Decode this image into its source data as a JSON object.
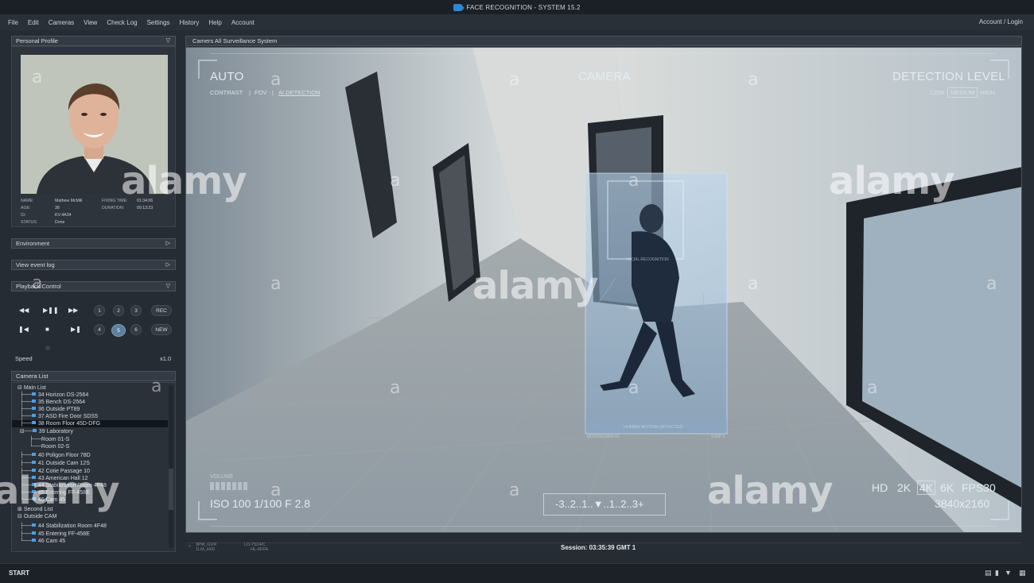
{
  "window": {
    "title": "FACE RECOGNITION - SYSTEM 15.2"
  },
  "menu": {
    "items": [
      "File",
      "Edit",
      "Cameras",
      "View",
      "Check Log",
      "Settings",
      "History",
      "Help",
      "Account"
    ],
    "account_login": "Account / Login"
  },
  "profile": {
    "header": "Personal Profile",
    "fields": {
      "name_label": "NAME:",
      "name": "Mathew McMill",
      "age_label": "AGE:",
      "age": "38",
      "id_label": "ID:",
      "id": "KV-4A34",
      "status_label": "STATUS:",
      "status": "Done",
      "fixing_label": "FIXING TIME:",
      "fixing": "01:34:06",
      "duration_label": "DURATION:",
      "duration": "00:13:23"
    }
  },
  "sections": {
    "environment": "Environment",
    "event_log": "View event log",
    "playback": "Playback Control"
  },
  "playback": {
    "buttons_row1": [
      "1",
      "2",
      "3"
    ],
    "rec": "REC",
    "buttons_row2": [
      "4",
      "5",
      "6"
    ],
    "new": "NEW",
    "active_channel": "5",
    "speed_label": "Speed",
    "speed_value": "x1.0"
  },
  "camera_list": {
    "header": "Camera List",
    "rows": [
      "Main List",
      "34 Horizon DS-2564",
      "35 Bench DS-2564",
      "36 Outside PT89",
      "37 ASD Fire Door SDS5",
      "38 Room Floor 45D-DFG",
      "39 Laboratory",
      "Room 01-S",
      "Room 02-S",
      "40 Poligon Floor 78D",
      "41 Outside Cam 12S",
      "42 Cotie Passage 10",
      "43 American Hall 12",
      "44 Stabilization Room 4F48",
      "45 Entering FF-458E",
      "46 Cam 45",
      "Second List",
      "Outside CAM",
      "44 Stabilization Room 4F48",
      "45 Entering FF-458E",
      "46 Cam 45"
    ]
  },
  "viewport": {
    "header": "Camers All Surveillance System",
    "auto": "AUTO",
    "modes": [
      "CONTRAST",
      "FOV",
      "AI DETECTION"
    ],
    "camera": "CAMERA",
    "detection_level": "DETECTION LEVEL",
    "levels": [
      "LOW",
      "MEDIUM",
      "HIGH"
    ],
    "facial_recognition": "FACIAL RECOGNITION",
    "human_motion": "HUMAN MOTION DETECTED",
    "motion_data_left": "MOTION DATA 01",
    "motion_data_right": "STEP 3",
    "volume": "VOLUME",
    "exposure": "ISO 100 1/100 F 2.8",
    "exposure_scale": "-3..2..1..▼..1..2..3+",
    "resolutions": [
      "HD",
      "2K",
      "4K",
      "6K"
    ],
    "selected_resolution": "4K",
    "fps": "FPS30",
    "dimensions": "3840x2160"
  },
  "status": {
    "codes_left": [
      "3PM_GVR",
      "1LM_H00"
    ],
    "codes_right": [
      "LO-7524/C",
      "HL-6FFA"
    ],
    "session": "Session: 03:35:39 GMT 1"
  },
  "taskbar": {
    "start": "START"
  },
  "watermark": {
    "brand": "alamy",
    "mark": "a"
  },
  "colors": {
    "accent": "#4a9fe4",
    "panel": "#2e343c",
    "chrome": "#1b2027"
  }
}
